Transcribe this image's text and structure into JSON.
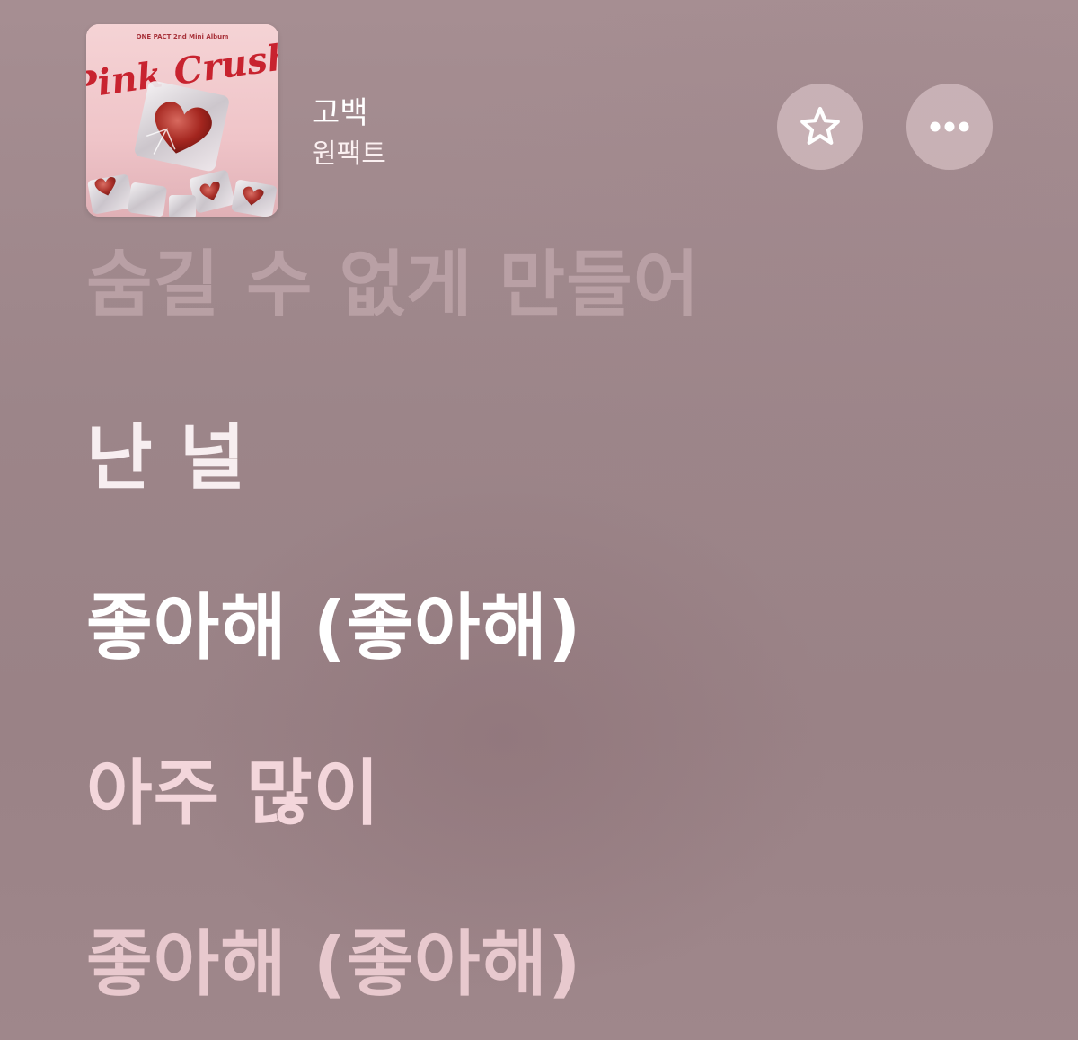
{
  "now_playing": {
    "album_art": {
      "cover_text_top": "ONE PACT 2nd Mini Album",
      "cover_logo_text": "Pink Crush"
    },
    "title": "고백",
    "artist": "원팩트",
    "favorite_icon": "star-outline-icon",
    "more_icon": "ellipsis-icon"
  },
  "lyrics": {
    "previous_line": "숨길 수 없게 만들어",
    "sung_line": "난 널",
    "current_line": "좋아해 (좋아해)",
    "next_line": "아주 많이",
    "next_line_2": "좋아해 (좋아해)"
  },
  "colors": {
    "background": "#9d8589",
    "lyric_active": "#ffffff",
    "lyric_upcoming": "#f3d6db",
    "button_bg": "#d9c3c7"
  }
}
